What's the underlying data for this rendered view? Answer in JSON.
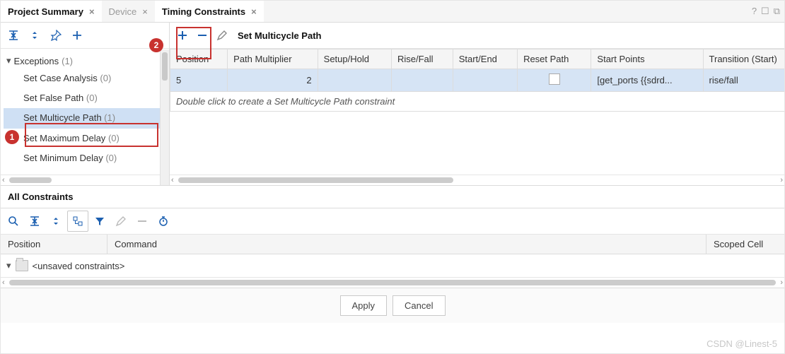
{
  "tabs": [
    {
      "label": "Project Summary",
      "closeable": true,
      "active": false,
      "bold": true
    },
    {
      "label": "Device",
      "closeable": true,
      "active": false,
      "bold": false
    },
    {
      "label": "Timing Constraints",
      "closeable": true,
      "active": true,
      "bold": true
    }
  ],
  "tree": {
    "header": "Exceptions",
    "header_count": "(1)",
    "items": [
      {
        "label": "Set Case Analysis",
        "count": "(0)"
      },
      {
        "label": "Set False Path",
        "count": "(0)"
      },
      {
        "label": "Set Multicycle Path",
        "count": "(1)",
        "selected": true
      },
      {
        "label": "Set Maximum Delay",
        "count": "(0)"
      },
      {
        "label": "Set Minimum Delay",
        "count": "(0)"
      }
    ]
  },
  "right": {
    "title": "Set Multicycle Path",
    "columns": [
      "Position",
      "Path Multiplier",
      "Setup/Hold",
      "Rise/Fall",
      "Start/End",
      "Reset Path",
      "Start Points",
      "Transition (Start)"
    ],
    "row": {
      "position": "5",
      "multiplier": "2",
      "setup": "",
      "risefall": "",
      "startend": "",
      "reset": "",
      "startpoints": "[get_ports {{sdrd...",
      "transition": "rise/fall"
    },
    "hint": "Double click to create a Set Multicycle Path constraint"
  },
  "bottom": {
    "title": "All Constraints",
    "columns": {
      "position": "Position",
      "command": "Command",
      "scoped": "Scoped Cell"
    },
    "unsaved": "<unsaved constraints>"
  },
  "buttons": {
    "apply": "Apply",
    "cancel": "Cancel"
  },
  "callouts": {
    "c1": "1",
    "c2": "2"
  },
  "watermark": "CSDN @Linest-5"
}
